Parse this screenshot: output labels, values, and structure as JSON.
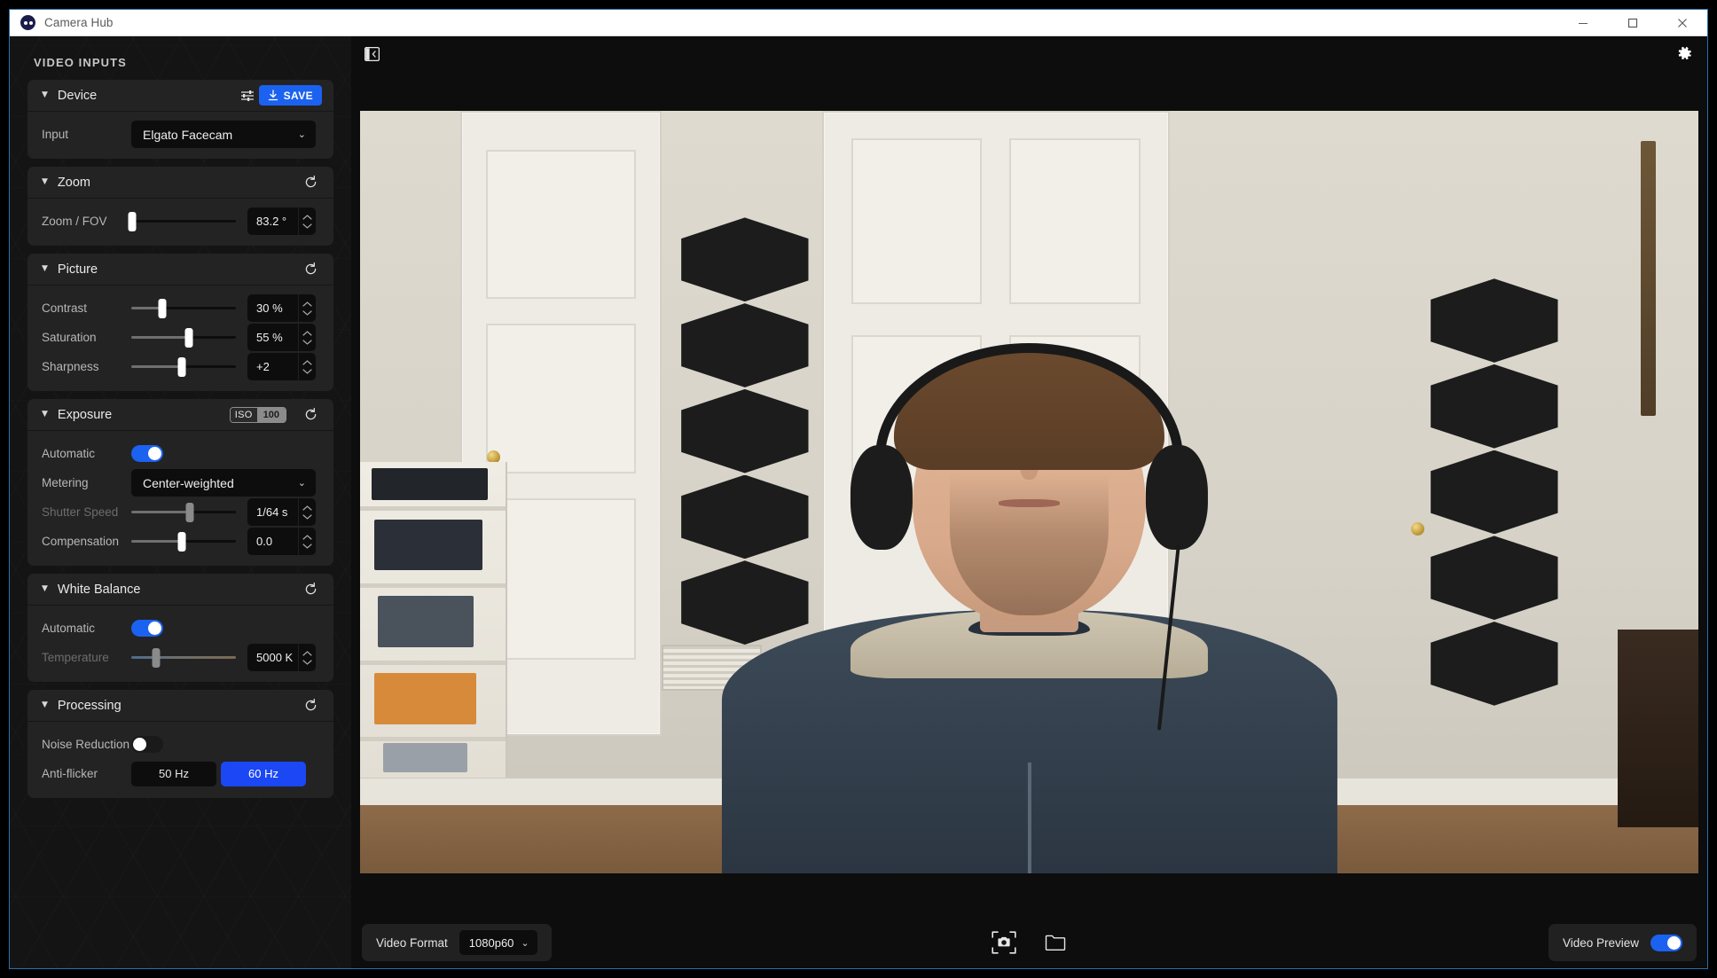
{
  "window": {
    "title": "Camera Hub",
    "logo_icon": "camera-hub-logo",
    "minimize_glyph": "—",
    "maximize_glyph": "☐",
    "close_glyph": "✕"
  },
  "sidebar": {
    "header": "VIDEO INPUTS",
    "panels": [
      {
        "id": "device",
        "title": "Device",
        "caret": "▼",
        "adjust_icon": "sliders-icon",
        "save_label": "SAVE",
        "save_icon": "download-icon",
        "rows": [
          {
            "type": "select",
            "label": "Input",
            "value": "Elgato Facecam",
            "chevron": "⌄"
          }
        ]
      },
      {
        "id": "zoom",
        "title": "Zoom",
        "caret": "▼",
        "reset_icon": "reset-icon",
        "rows": [
          {
            "type": "slider",
            "label": "Zoom / FOV",
            "value": "83.2 °",
            "percent": 1,
            "fill": 0
          }
        ]
      },
      {
        "id": "picture",
        "title": "Picture",
        "caret": "▼",
        "reset_icon": "reset-icon",
        "rows": [
          {
            "type": "slider",
            "label": "Contrast",
            "value": "30 %",
            "percent": 30,
            "fill": 30
          },
          {
            "type": "slider",
            "label": "Saturation",
            "value": "55 %",
            "percent": 55,
            "fill": 55
          },
          {
            "type": "slider",
            "label": "Sharpness",
            "value": "+2",
            "percent": 48,
            "fill": 48
          }
        ]
      },
      {
        "id": "exposure",
        "title": "Exposure",
        "caret": "▼",
        "reset_icon": "reset-icon",
        "iso_label": "ISO",
        "iso_value": "100",
        "rows": [
          {
            "type": "toggle",
            "label": "Automatic",
            "state": "on"
          },
          {
            "type": "select",
            "label": "Metering",
            "value": "Center-weighted",
            "chevron": "⌄"
          },
          {
            "type": "slider",
            "label": "Shutter Speed",
            "value": "1/64 s",
            "percent": 56,
            "fill": 56,
            "disabled": true
          },
          {
            "type": "slider",
            "label": "Compensation",
            "value": "0.0",
            "percent": 48,
            "fill": 48
          }
        ]
      },
      {
        "id": "white-balance",
        "title": "White Balance",
        "caret": "▼",
        "reset_icon": "reset-icon",
        "rows": [
          {
            "type": "toggle",
            "label": "Automatic",
            "state": "on"
          },
          {
            "type": "slider",
            "label": "Temperature",
            "value": "5000 K",
            "percent": 24,
            "fill": 0,
            "disabled": true,
            "gradient": true
          }
        ]
      },
      {
        "id": "processing",
        "title": "Processing",
        "caret": "▼",
        "reset_icon": "reset-icon",
        "rows": [
          {
            "type": "toggle",
            "label": "Noise Reduction",
            "state": "off"
          },
          {
            "type": "segmented",
            "label": "Anti-flicker",
            "options": [
              "50 Hz",
              "60 Hz"
            ],
            "selected": "60 Hz"
          }
        ]
      }
    ]
  },
  "preview": {
    "collapse_icon": "collapse-panel-icon",
    "settings_icon": "gear-icon"
  },
  "bottom": {
    "video_format_label": "Video Format",
    "video_format_value": "1080p60",
    "video_format_chevron": "⌄",
    "snapshot_icon": "camera-snapshot-icon",
    "folder_icon": "folder-icon",
    "video_preview_label": "Video Preview",
    "video_preview_state": "on"
  },
  "colors": {
    "accent_blue": "#1b62f0",
    "segment_active_blue": "#1b47f5",
    "panel_bg": "#232323",
    "window_border": "#2a6fa8",
    "field_bg": "#0d0d0d"
  }
}
